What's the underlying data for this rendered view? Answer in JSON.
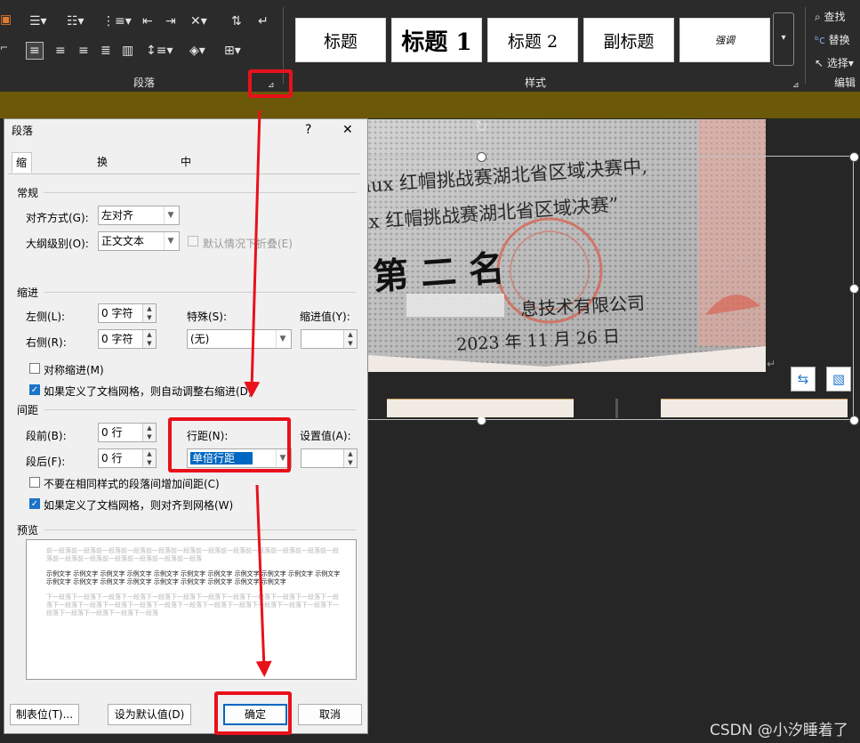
{
  "ribbon": {
    "paragraph_group_label": "段落",
    "styles_group_label": "样式",
    "editing_group_label": "编辑",
    "styles": [
      "标题",
      "标题 1",
      "标题 2",
      "副标题",
      "强调"
    ],
    "editing": {
      "find": "查找",
      "replace": "替换",
      "select": "选择"
    }
  },
  "dialog": {
    "title": "段落",
    "help": "?",
    "close": "✕",
    "tabs": [
      "缩进和间距(I)",
      "换行和分页(P)",
      "中文版式(H)"
    ],
    "general": {
      "section": "常规",
      "alignment_label": "对齐方式(G):",
      "alignment_value": "左对齐",
      "outline_label": "大纲级别(O):",
      "outline_value": "正文文本",
      "collapse_label": "默认情况下折叠(E)"
    },
    "indent": {
      "section": "缩进",
      "left_label": "左侧(L):",
      "left_value": "0 字符",
      "right_label": "右侧(R):",
      "right_value": "0 字符",
      "special_label": "特殊(S):",
      "special_value": "(无)",
      "indent_by_label": "缩进值(Y):",
      "mirror_label": "对称缩进(M)",
      "auto_adjust_label": "如果定义了文档网格，则自动调整右缩进(D)"
    },
    "spacing": {
      "section": "间距",
      "before_label": "段前(B):",
      "before_value": "0 行",
      "after_label": "段后(F):",
      "after_value": "0 行",
      "line_spacing_label": "行距(N):",
      "line_spacing_value": "单倍行距",
      "at_label": "设置值(A):",
      "no_space_same_style_label": "不要在相同样式的段落间增加间距(C)",
      "snap_to_grid_label": "如果定义了文档网格，则对齐到网格(W)"
    },
    "preview": {
      "section": "预览",
      "prev_text": "前一段落前一段落前一段落前一段落前一段落前一段落前一段落前一段落前一段落前一段落前一段落前一段落前一段落前一段落前一段落前一段落前一段落前一段落",
      "sample_text": "示例文字 示例文字 示例文字 示例文字 示例文字 示例文字 示例文字 示例文字 示例文字 示例文字 示例文字 示例文字 示例文字 示例文字 示例文字 示例文字 示例文字 示例文字 示例文字 示例文字",
      "next_text": "下一段落下一段落下一段落下一段落下一段落下一段落下一段落下一段落下一段落下一段落下一段落下一段落下一段落下一段落下一段落下一段落下一段落下一段落下一段落下一段落下一段落下一段落下一段落下一段落下一段落下一段落下一段落下一段落"
    },
    "buttons": {
      "tabs": "制表位(T)...",
      "set_default": "设为默认值(D)",
      "ok": "确定",
      "cancel": "取消"
    }
  },
  "document": {
    "certificate_line1": "nux 红帽挑战赛湖北省区域决赛中,",
    "certificate_line2": "ux 红帽挑战赛湖北省区域决赛”",
    "certificate_rank": "第 二 名",
    "certificate_company": "息技术有限公司",
    "certificate_date": "2023 年 11 月 26 日"
  },
  "watermark": "CSDN @小汐睡着了",
  "colors": {
    "annotation_red": "#e8111b",
    "ribbon_bg": "#2b2b2b",
    "olive_bar": "#6b5808",
    "dialog_bg": "#f0f0f0",
    "selection_blue": "#0067c0"
  }
}
